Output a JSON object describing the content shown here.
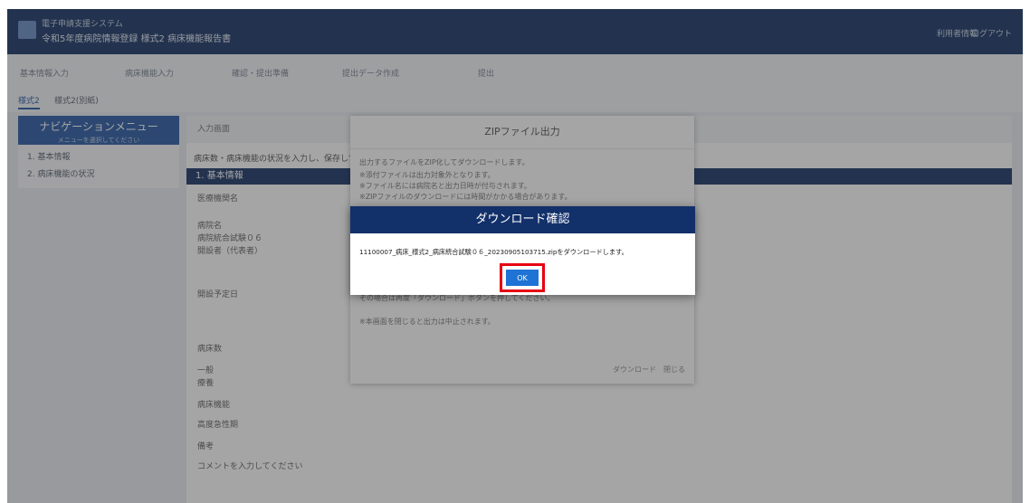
{
  "header": {
    "system": "電子申請支援システム",
    "title": "令和5年度病院情報登録 様式2 病床機能報告書",
    "right_links": [
      "利用者情報",
      "ログアウト"
    ]
  },
  "steps": [
    "基本情報入力",
    "病床機能入力",
    "確認・提出準備",
    "提出データ作成",
    "提出"
  ],
  "tabs": [
    "様式2",
    "様式2(別紙)"
  ],
  "nav": {
    "title": "ナビゲーションメニュー",
    "subtitle": "メニューを選択してください",
    "items": [
      "1. 基本情報",
      "2. 病床機能の状況"
    ]
  },
  "main": {
    "bar": "入力画面",
    "info": "病床数・病床機能の状況を入力し、保存してください。",
    "section": "1. 基本情報",
    "labels": [
      "医療機関名",
      "病院名",
      "病院統合試験０６",
      "開設者（代表者）",
      "開設予定日",
      "病床数",
      "一般",
      "療養",
      "病床機能",
      "高度急性期",
      "備考",
      "コメントを入力してください"
    ]
  },
  "zip_panel": {
    "title": "ZIPファイル出力",
    "lines": [
      "出力するファイルをZIP化してダウンロードします。",
      "※添付ファイルは出力対象外となります。",
      "※ファイル名には病院名と出力日時が付与されます。",
      "※ZIPファイルのダウンロードには時間がかかる場合があります。",
      "その場合は再度「ダウンロード」ボタンを押してください。",
      "※本画面を閉じると出力は中止されます。"
    ],
    "footer": "ダウンロード　閉じる"
  },
  "dialog": {
    "title": "ダウンロード確認",
    "message": "11100007_病床_様式2_病床統合試験０６_20230905103715.zipをダウンロードします。",
    "ok_label": "OK"
  },
  "colors": {
    "dialog_header": "#12306a",
    "ok_button": "#1f73d4",
    "highlight_box": "#e60012"
  }
}
